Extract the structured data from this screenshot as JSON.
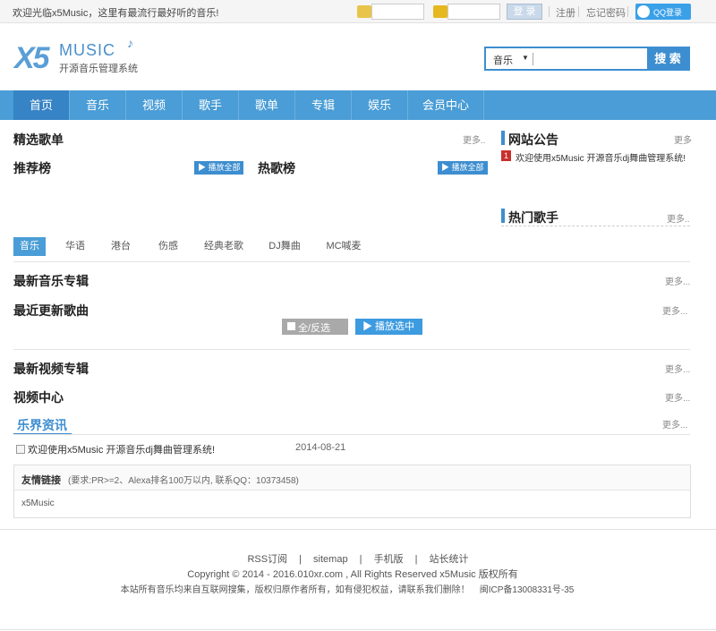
{
  "topbar": {
    "welcome": "欢迎光临x5Music，这里有最流行最好听的音乐!",
    "login": "登 录",
    "register": "注册",
    "forgot": "忘记密码",
    "qq_login": "QQ登录"
  },
  "logo": {
    "x5": "X5",
    "music": "MUSIC",
    "subtitle": "开源音乐管理系统"
  },
  "search": {
    "category": "音乐",
    "button": "搜 索"
  },
  "nav": [
    "首页",
    "音乐",
    "视频",
    "歌手",
    "歌单",
    "专辑",
    "娱乐",
    "会员中心"
  ],
  "sections": {
    "featured_playlist": "精选歌单",
    "recommended": "推荐榜",
    "hot": "热歌榜",
    "play_all": "▶ 播放全部",
    "latest_album": "最新音乐专辑",
    "latest_songs": "最近更新歌曲",
    "select_all": "全/反选",
    "play_selected": "▶ 播放选中",
    "latest_video_album": "最新视频专辑",
    "video_center": "视频中心",
    "entertainment": "乐界资讯",
    "more": "更多..",
    "more2": "更多",
    "more3": "更多..."
  },
  "music_tabs": [
    "音乐",
    "华语",
    "港台",
    "伤感",
    "经典老歌",
    "DJ舞曲",
    "MC喊麦"
  ],
  "news": {
    "title": "欢迎使用x5Music 开源音乐dj舞曲管理系统!",
    "date": "2014-08-21"
  },
  "sidebar": {
    "announcement": "网站公告",
    "ann_badge": "1",
    "ann_text": "欢迎使用x5Music 开源音乐dj舞曲管理系统!",
    "hot_singers": "热门歌手"
  },
  "friend_links": {
    "title": "友情链接",
    "note": "(要求:PR>=2、Alexa排名100万以内, 联系QQ：10373458)",
    "link": "x5Music"
  },
  "footer": {
    "links": [
      "RSS订阅",
      "sitemap",
      "手机版",
      "站长统计"
    ],
    "separator": "|",
    "copyright": "Copyright © 2014 - 2016.010xr.com , All Rights Reserved x5Music 版权所有",
    "disclaimer": "本站所有音乐均来自互联网搜集，版权归原作者所有，如有侵犯权益，请联系我们删除！    闽ICP备13008331号-35"
  }
}
